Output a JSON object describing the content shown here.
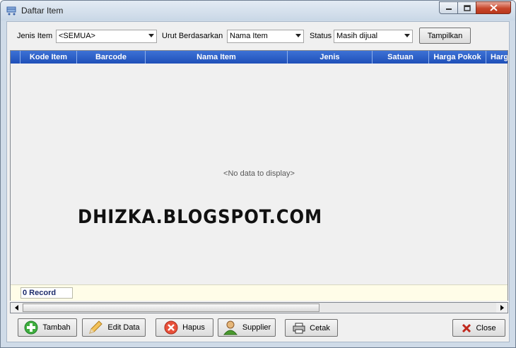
{
  "window": {
    "title": "Daftar Item"
  },
  "filters": {
    "jenis_label": "Jenis Item",
    "jenis_value": "<SEMUA>",
    "urut_label": "Urut Berdasarkan",
    "urut_value": "Nama Item",
    "status_label": "Status",
    "status_value": "Masih dijual",
    "tampilkan_label": "Tampilkan"
  },
  "grid": {
    "columns": [
      "Kode Item",
      "Barcode",
      "Nama Item",
      "Jenis",
      "Satuan",
      "Harga Pokok",
      "Harg"
    ],
    "empty_text": "<No data to display>",
    "record_count": "0 Record"
  },
  "watermark": "DHIZKA.BLOGSPOT.COM",
  "toolbar": {
    "tambah": "Tambah",
    "edit": "Edit Data",
    "hapus": "Hapus",
    "supplier": "Supplier",
    "cetak": "Cetak",
    "close": "Close"
  },
  "colors": {
    "header": "#2a5cc6",
    "footer": "#fffde8",
    "record_text": "#1b2a6b"
  }
}
